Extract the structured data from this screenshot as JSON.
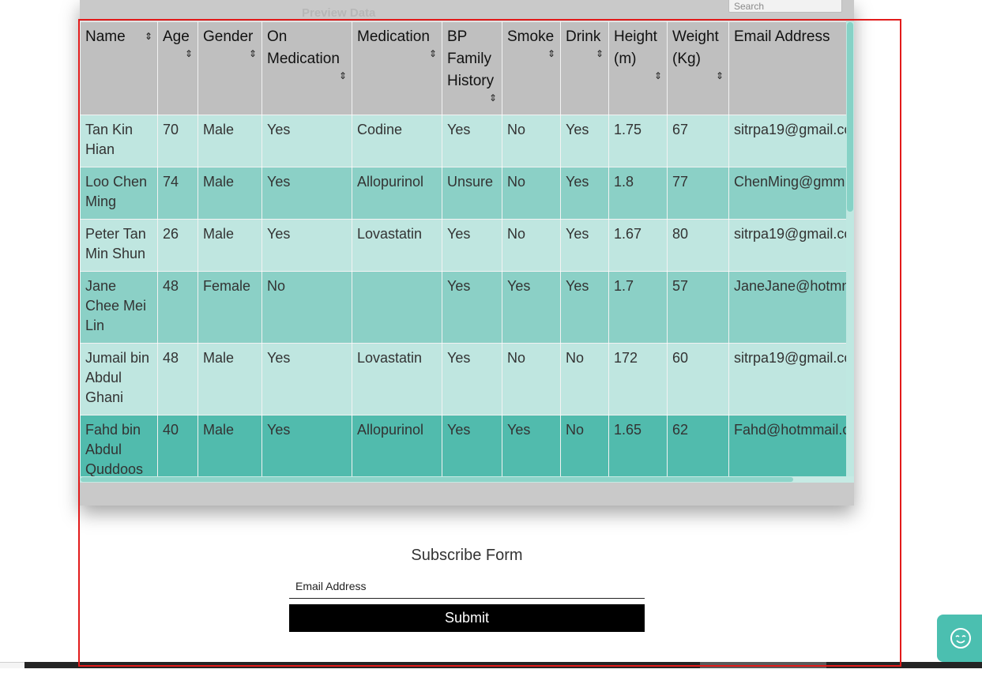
{
  "background_dialog": {
    "title": "Preview Data",
    "search_placeholder": "Search"
  },
  "table": {
    "columns": [
      {
        "label": "Name",
        "sortable": true
      },
      {
        "label": "Age",
        "sortable": true
      },
      {
        "label": "Gender",
        "sortable": true
      },
      {
        "label": "On Medication",
        "sortable": true
      },
      {
        "label": "Medication",
        "sortable": true
      },
      {
        "label": "BP Family History",
        "sortable": true
      },
      {
        "label": "Smoke",
        "sortable": true
      },
      {
        "label": "Drink",
        "sortable": true
      },
      {
        "label": "Height (m)",
        "sortable": true
      },
      {
        "label": "Weight (Kg)",
        "sortable": true
      },
      {
        "label": "Email Address",
        "sortable": false
      }
    ],
    "sort_glyph": "⇕",
    "rows": [
      [
        "Tan Kin Hian",
        "70",
        "Male",
        "Yes",
        "Codine",
        "Yes",
        "No",
        "Yes",
        "1.75",
        "67",
        "sitrpa19@gmail.co"
      ],
      [
        "Loo Chen Ming",
        "74",
        "Male",
        "Yes",
        "Allopurinol",
        "Unsure",
        "No",
        "Yes",
        "1.8",
        "77",
        "ChenMing@gmm"
      ],
      [
        "Peter Tan Min Shun",
        "26",
        "Male",
        "Yes",
        "Lovastatin",
        "Yes",
        "No",
        "Yes",
        "1.67",
        "80",
        "sitrpa19@gmail.co"
      ],
      [
        "Jane Chee Mei Lin",
        "48",
        "Female",
        "No",
        "",
        "Yes",
        "Yes",
        "Yes",
        "1.7",
        "57",
        "JaneJane@hotmn"
      ],
      [
        "Jumail bin Abdul Ghani",
        "48",
        "Male",
        "Yes",
        "Lovastatin",
        "Yes",
        "No",
        "No",
        "172",
        "60",
        "sitrpa19@gmail.co"
      ],
      [
        "Fahd bin Abdul Quddoos",
        "40",
        "Male",
        "Yes",
        "Allopurinol",
        "Yes",
        "Yes",
        "No",
        "1.65",
        "62",
        "Fahd@hotmmail.c"
      ]
    ]
  },
  "subscribe": {
    "title": "Subscribe Form",
    "email_placeholder": "Email Address",
    "submit_label": "Submit"
  },
  "chat": {
    "icon": "chat-smile-icon"
  },
  "colors": {
    "header_bg": "#bebebe",
    "row_light": "#bee8e2",
    "row_mid": "#86d1c6",
    "row_dark": "#4cbaac",
    "selection": "#e21b1b",
    "chat": "#4bbfb0"
  }
}
